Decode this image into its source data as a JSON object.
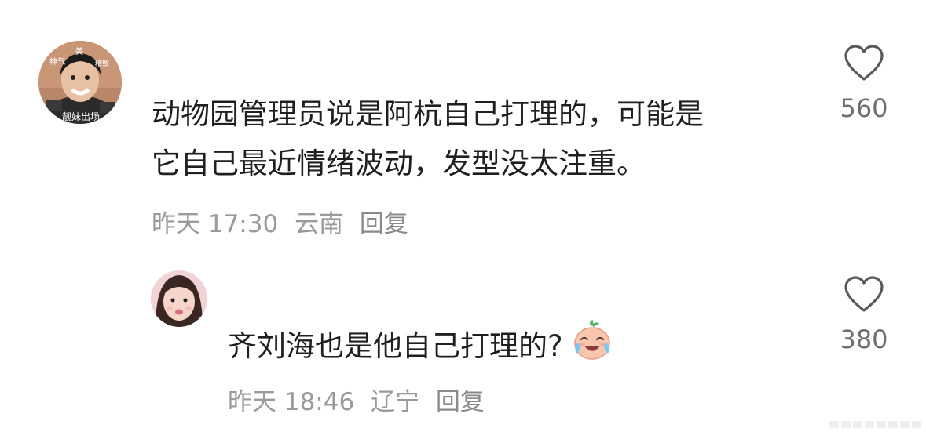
{
  "comments": [
    {
      "text_line1": "动物园管理员说是阿杭自己打理的，可能是",
      "text_line2": "它自己最近情绪波动，发型没太注重。",
      "time": "昨天 17:30",
      "location": "云南",
      "reply_label": "回复",
      "likes": "560",
      "avatar_text_top_left": "神气",
      "avatar_text_top": "美",
      "avatar_text_right": "精致",
      "avatar_text_bottom": "靓妹出场"
    },
    {
      "text": "齐刘海也是他自己打理的?",
      "time": "昨天 18:46",
      "location": "辽宁",
      "reply_label": "回复",
      "likes": "380",
      "emoji": "crying-laughing-face"
    }
  ],
  "icons": {
    "like": "heart-outline-icon"
  },
  "colors": {
    "text": "#1f1f1f",
    "meta": "#9a9a9a",
    "like_count": "#6f6f6f",
    "heart_stroke": "#5a5a5a"
  }
}
